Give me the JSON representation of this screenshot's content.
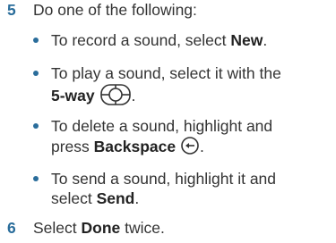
{
  "steps": [
    {
      "number": "5",
      "text": "Do one of the following:",
      "bullets": [
        {
          "line1_pre": "To record a sound, select ",
          "line1_bold": "New",
          "line1_post": "."
        },
        {
          "line1_pre": "To play a sound, select it with the",
          "line2_bold": "5-way",
          "line2_post": ".",
          "icon": "5-way-navigator-icon"
        },
        {
          "line1_pre": "To delete a sound, highlight and",
          "line2_pre": "press ",
          "line2_bold": "Backspace",
          "line2_post": ".",
          "icon": "backspace-key-icon"
        },
        {
          "line1_pre": "To send a sound, highlight it and",
          "line2_pre": "select ",
          "line2_bold": "Send",
          "line2_post": "."
        }
      ]
    },
    {
      "number": "6",
      "text_pre": "Select ",
      "text_bold": "Done",
      "text_post": " twice."
    }
  ],
  "colors": {
    "step_number": "#2a6d9b",
    "bullet": "#2a6d9b",
    "text": "#333333"
  }
}
